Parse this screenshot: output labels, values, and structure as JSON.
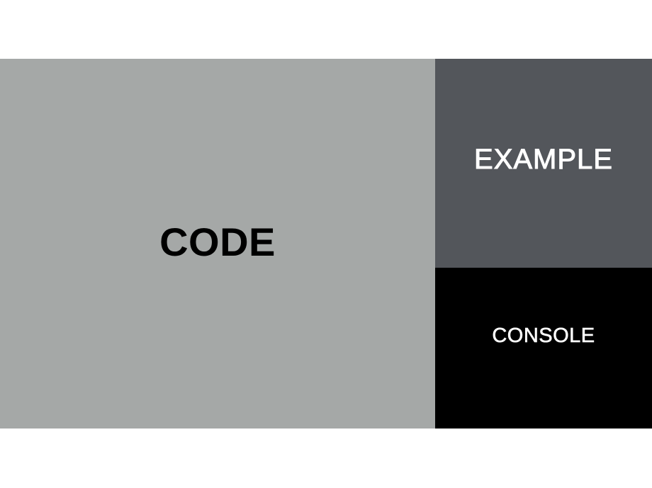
{
  "panels": {
    "code": {
      "label": "CODE",
      "background": "#a5a8a7",
      "text_color": "#000000"
    },
    "example": {
      "label": "EXAMPLE",
      "background": "#53565b",
      "text_color": "#ffffff"
    },
    "console": {
      "label": "CONSOLE",
      "background": "#000000",
      "text_color": "#ffffff"
    }
  }
}
